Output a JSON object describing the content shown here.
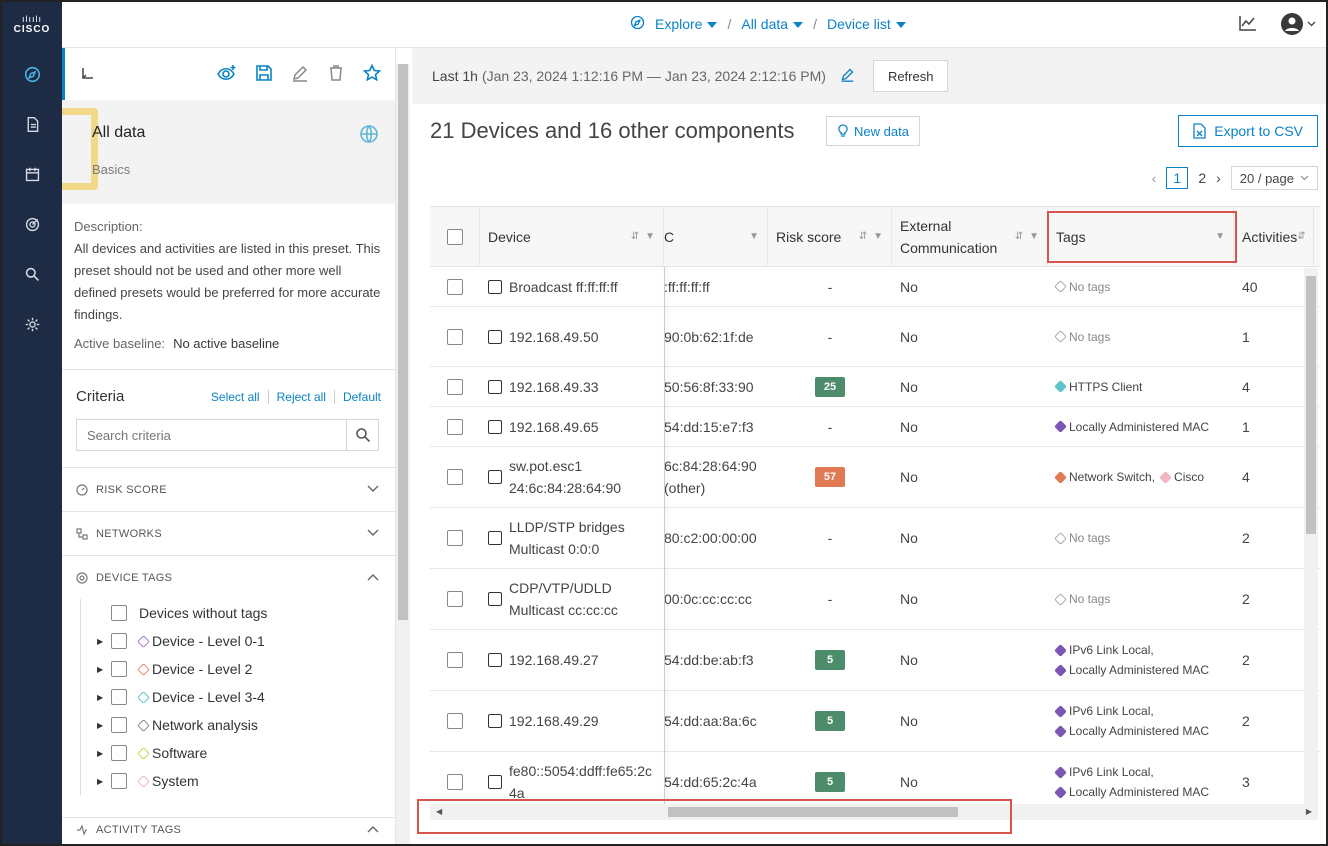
{
  "brand": {
    "bars": "ılıılı",
    "word": "CISCO"
  },
  "breadcrumbs": [
    "Explore",
    "All data",
    "Device list"
  ],
  "sidebar": {
    "title": "All data",
    "subtitle": "Basics",
    "description_label": "Description:",
    "description": "All devices and activities are listed in this preset. This preset should not be used and other more well defined presets would be preferred for more accurate findings.",
    "baseline_label": "Active baseline:",
    "baseline_value": "No active baseline",
    "criteria_title": "Criteria",
    "select_all": "Select all",
    "reject_all": "Reject all",
    "default": "Default",
    "search_placeholder": "Search criteria",
    "sections": [
      "RISK SCORE",
      "NETWORKS",
      "DEVICE TAGS",
      "ACTIVITY TAGS"
    ],
    "tags": [
      {
        "label": "Devices without tags",
        "color": ""
      },
      {
        "label": "Device - Level 0-1",
        "color": "#a77bd9"
      },
      {
        "label": "Device - Level 2",
        "color": "#e48b6f"
      },
      {
        "label": "Device - Level 3-4",
        "color": "#5fc4c9"
      },
      {
        "label": "Network analysis",
        "color": "#8a8a8a"
      },
      {
        "label": "Software",
        "color": "#c9d44a"
      },
      {
        "label": "System",
        "color": "#f0b6bf"
      }
    ]
  },
  "main": {
    "time_label": "Last 1h",
    "time_range": "(Jan 23, 2024 1:12:16 PM — Jan 23, 2024 2:12:16 PM)",
    "refresh": "Refresh",
    "heading": "21 Devices and 16 other components",
    "new_data": "New data",
    "export": "Export to CSV",
    "pager": {
      "page1": "1",
      "page2": "2",
      "size": "20 / page"
    },
    "columns": {
      "device": "Device",
      "mac": "C",
      "risk": "Risk score",
      "ext": "External Communication",
      "tags": "Tags",
      "activities": "Activities"
    },
    "rows": [
      {
        "device": "Broadcast ff:ff:ff:ff",
        "mac": ":ff:ff:ff:ff",
        "risk": "-",
        "risk_color": "",
        "ext": "No",
        "tags": [],
        "act": "40",
        "h": 40
      },
      {
        "device": "192.168.49.50",
        "mac": "90:0b:62:1f:de",
        "risk": "-",
        "risk_color": "",
        "ext": "No",
        "tags": [],
        "act": "1",
        "h": 60
      },
      {
        "device": "192.168.49.33",
        "mac": "50:56:8f:33:90",
        "risk": "25",
        "risk_color": "#4c8c6a",
        "ext": "No",
        "tags": [
          {
            "label": "HTTPS Client",
            "color": "#5fc4c9"
          }
        ],
        "act": "4",
        "h": 40
      },
      {
        "device": "192.168.49.65",
        "mac": "54:dd:15:e7:f3",
        "risk": "-",
        "risk_color": "",
        "ext": "No",
        "tags": [
          {
            "label": "Locally Administered MAC",
            "color": "#7b57b3"
          }
        ],
        "act": "1",
        "h": 40
      },
      {
        "device": "sw.pot.esc1",
        "device2": "24:6c:84:28:64:90",
        "mac": "6c:84:28:64:90",
        "mac2": "(other)",
        "risk": "57",
        "risk_color": "#e07a55",
        "ext": "No",
        "tags": [
          {
            "label": "Network Switch,",
            "color": "#e07a55"
          },
          {
            "label": "Cisco",
            "color": "#f0b6bf"
          }
        ],
        "inline_tags": true,
        "act": "4",
        "h": 61
      },
      {
        "device": "LLDP/STP bridges",
        "device2": "Multicast 0:0:0",
        "mac": "80:c2:00:00:00",
        "risk": "-",
        "risk_color": "",
        "ext": "No",
        "tags": [],
        "act": "2",
        "h": 61
      },
      {
        "device": "CDP/VTP/UDLD",
        "device2": "Multicast cc:cc:cc",
        "mac": "00:0c:cc:cc:cc",
        "risk": "-",
        "risk_color": "",
        "ext": "No",
        "tags": [],
        "act": "2",
        "h": 61
      },
      {
        "device": "192.168.49.27",
        "mac": "54:dd:be:ab:f3",
        "risk": "5",
        "risk_color": "#4c8c6a",
        "ext": "No",
        "tags": [
          {
            "label": "IPv6 Link Local,",
            "color": "#7b57b3"
          },
          {
            "label": "Locally Administered MAC",
            "color": "#7b57b3"
          }
        ],
        "act": "2",
        "h": 61
      },
      {
        "device": "192.168.49.29",
        "mac": "54:dd:aa:8a:6c",
        "risk": "5",
        "risk_color": "#4c8c6a",
        "ext": "No",
        "tags": [
          {
            "label": "IPv6 Link Local,",
            "color": "#7b57b3"
          },
          {
            "label": "Locally Administered MAC",
            "color": "#7b57b3"
          }
        ],
        "act": "2",
        "h": 61
      },
      {
        "device": "fe80::5054:ddff:fe65:2c",
        "device2": "4a",
        "mac": "54:dd:65:2c:4a",
        "risk": "5",
        "risk_color": "#4c8c6a",
        "ext": "No",
        "tags": [
          {
            "label": "IPv6 Link Local,",
            "color": "#7b57b3"
          },
          {
            "label": "Locally Administered MAC",
            "color": "#7b57b3"
          }
        ],
        "act": "3",
        "h": 61
      }
    ],
    "no_tags": "No tags"
  }
}
